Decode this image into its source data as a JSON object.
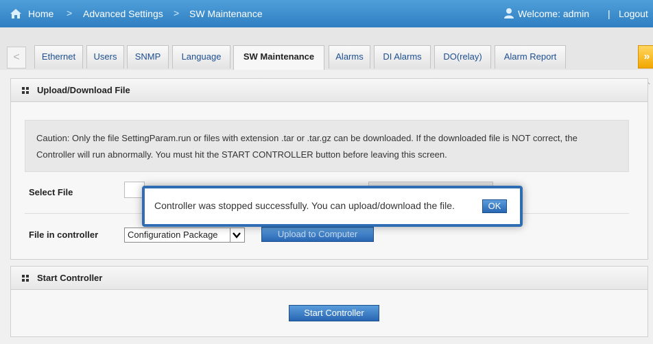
{
  "header": {
    "breadcrumb": [
      "Home",
      "Advanced Settings",
      "SW Maintenance"
    ],
    "separator": ">",
    "welcome": "Welcome:  admin",
    "divider": "|",
    "logout": "Logout"
  },
  "tabs": {
    "items": [
      "Ethernet",
      "Users",
      "SNMP",
      "Language",
      "SW Maintenance",
      "Alarms",
      "DI Alarms",
      "DO(relay)",
      "Alarm Report"
    ],
    "active": "SW Maintenance",
    "left_arrow": "<",
    "right_arrow": "»"
  },
  "upload_panel": {
    "title": "Upload/Download File",
    "caution": "Caution: Only the file SettingParam.run or files with extension .tar or .tar.gz can be downloaded. If the downloaded file is NOT correct, the Controller will run abnormally. You must hit the START CONTROLLER button before leaving this screen.",
    "select_file_label": "Select File",
    "file_in_controller_label": "File in controller",
    "file_select_value": "Configuration Package",
    "upload_button": "Upload to Computer"
  },
  "start_panel": {
    "title": "Start Controller",
    "button": "Start Controller"
  },
  "dialog": {
    "message": "Controller was stopped successfully. You can upload/download the file.",
    "ok": "OK"
  },
  "colors": {
    "header_blue": "#3a8ccf",
    "button_blue": "#2866b3",
    "dialog_border": "#2e6cb4",
    "next_arrow": "#f2a700"
  }
}
